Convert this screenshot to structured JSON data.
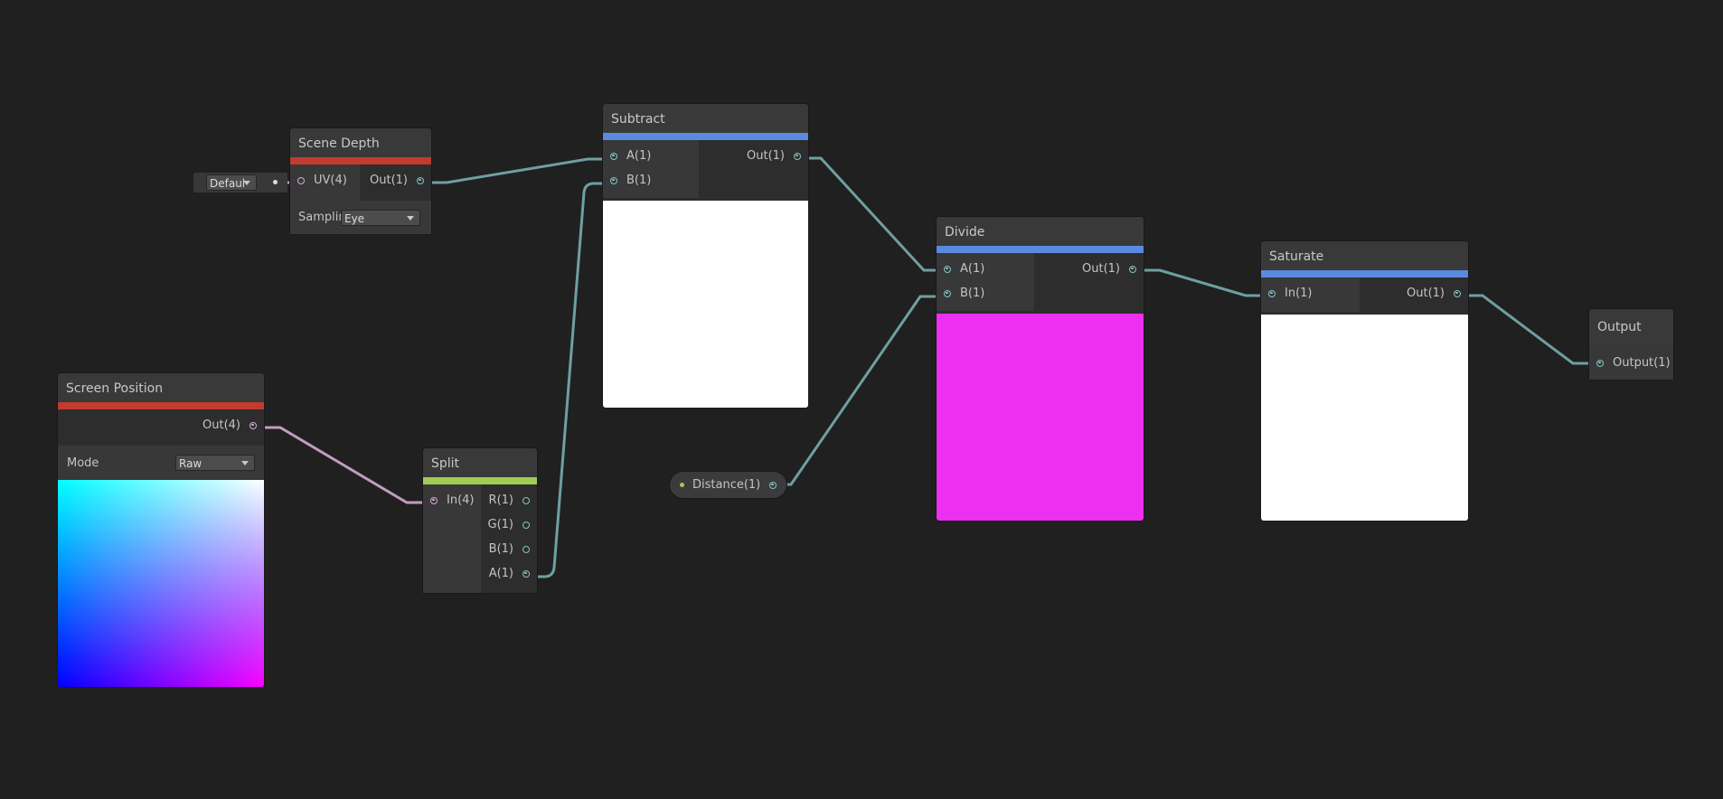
{
  "canvas": {
    "background": "#202020",
    "wire_float": "#6f9fa2",
    "wire_vector": "#c49cc0"
  },
  "inline_input": {
    "value": "Default"
  },
  "nodes": {
    "scene_depth": {
      "title": "Scene Depth",
      "accent": "#c23b2e",
      "inputs": [
        "UV(4)"
      ],
      "outputs": [
        "Out(1)"
      ],
      "sampling_label": "Samplin",
      "sampling_value": "Eye"
    },
    "screen_position": {
      "title": "Screen Position",
      "accent": "#c23b2e",
      "outputs": [
        "Out(4)"
      ],
      "mode_label": "Mode",
      "mode_value": "Raw"
    },
    "split": {
      "title": "Split",
      "accent": "#9fcb56",
      "inputs": [
        "In(4)"
      ],
      "outputs": [
        "R(1)",
        "G(1)",
        "B(1)",
        "A(1)"
      ]
    },
    "subtract": {
      "title": "Subtract",
      "accent": "#5a8ae0",
      "inputs": [
        "A(1)",
        "B(1)"
      ],
      "outputs": [
        "Out(1)"
      ],
      "preview_color": "#ffffff"
    },
    "distance": {
      "label": "Distance(1)"
    },
    "divide": {
      "title": "Divide",
      "accent": "#5a8ae0",
      "inputs": [
        "A(1)",
        "B(1)"
      ],
      "outputs": [
        "Out(1)"
      ],
      "preview_color": "#ec2ff0"
    },
    "saturate": {
      "title": "Saturate",
      "accent": "#5a8ae0",
      "inputs": [
        "In(1)"
      ],
      "outputs": [
        "Out(1)"
      ],
      "preview_color": "#ffffff"
    },
    "output": {
      "title": "Output",
      "inputs": [
        "Output(1)"
      ]
    }
  }
}
